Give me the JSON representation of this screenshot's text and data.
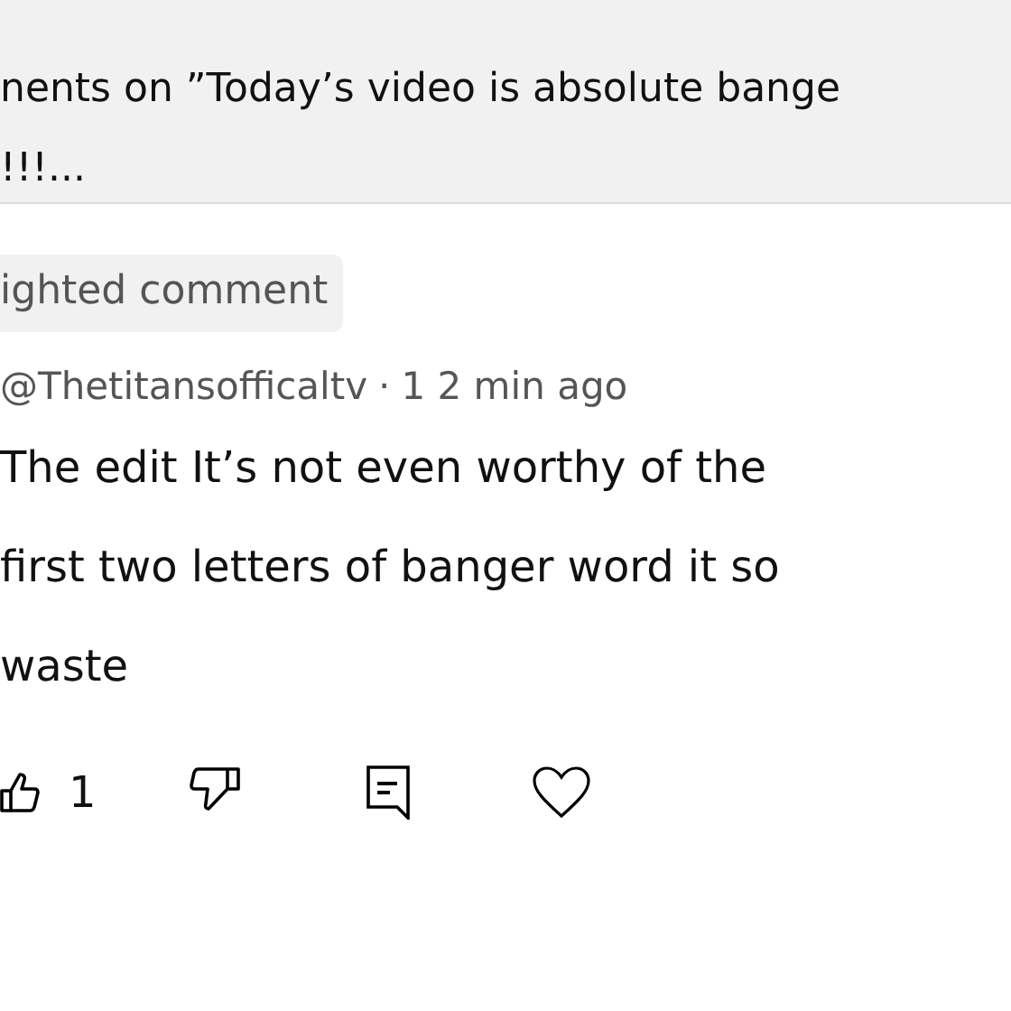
{
  "video_header": {
    "lines": [
      "nents on ”Today’s video is absolute bange",
      "!!!..."
    ]
  },
  "comment": {
    "badge": "ighted comment",
    "author": "@Thetitansofficaltv",
    "separator": "·",
    "time": "1 2 min ago",
    "text_lines": [
      "The edit It’s not even worthy of the",
      "first two letters of banger word it so",
      "waste"
    ],
    "like_count": "1"
  }
}
